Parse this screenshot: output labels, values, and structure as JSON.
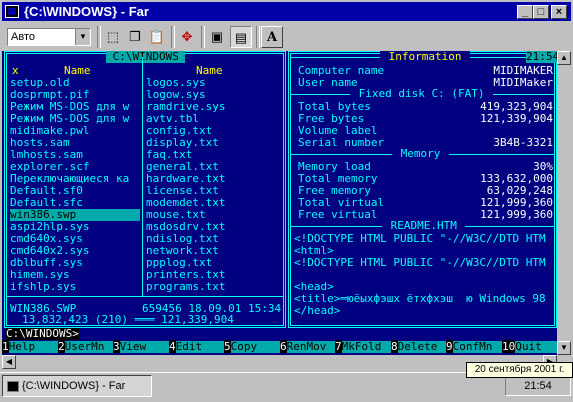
{
  "window": {
    "title": "{C:\\WINDOWS} - Far",
    "min_label": "_",
    "max_label": "□",
    "close_label": "×"
  },
  "toolbar": {
    "font_combo": "Авто",
    "icons": [
      "mark-icon",
      "copy-icon",
      "paste-icon",
      "fullscreen-icon",
      "properties-icon",
      "background-icon",
      "font-icon"
    ],
    "font_button": "A"
  },
  "left_panel": {
    "path": " C:\\WINDOWS ",
    "col_mark": "x",
    "col1_header": "Name",
    "col2_header": "Name",
    "col1": [
      "setup.old",
      "dosprmpt.pif",
      "Режим MS-DOS для w",
      "Режим MS-DOS для w",
      "midimake.pwl",
      "hosts.sam",
      "lmhosts.sam",
      "explorer.scf",
      "Переключающиеся ка",
      "Default.sf0",
      "Default.sfc",
      "win386.swp",
      "aspi2hlp.sys",
      "cmd640x.sys",
      "cmd640x2.sys",
      "dblbuff.sys",
      "himem.sys",
      "ifshlp.sys"
    ],
    "col2": [
      "logos.sys",
      "logow.sys",
      "ramdrive.sys",
      "avtv.tbl",
      "config.txt",
      "display.txt",
      "faq.txt",
      "general.txt",
      "hardware.txt",
      "license.txt",
      "modemdet.txt",
      "mouse.txt",
      "msdosdrv.txt",
      "ndislog.txt",
      "network.txt",
      "ppplog.txt",
      "printers.txt",
      "programs.txt"
    ],
    "selected_index": 11,
    "status_name": "WIN386.SWP",
    "status_info": "659456 18.09.01 15:34",
    "totals": "13,832,423 (210) ═══ 121,339,904"
  },
  "right_panel": {
    "info_title": " Information ",
    "clock": "21:54",
    "computer_label": "Computer name",
    "computer_value": "MIDIMAKER",
    "user_label": "User name",
    "user_value": "MIDIMaker",
    "disk_title": " Fixed disk C: (FAT) ",
    "total_bytes_label": "Total bytes",
    "total_bytes_value": "419,323,904",
    "free_bytes_label": "Free bytes",
    "free_bytes_value": "121,339,904",
    "volume_label": "Volume label",
    "serial_label": "Serial number",
    "serial_value": "3B4B-3321",
    "memory_title": " Memory ",
    "mem_load_label": "Memory load",
    "mem_load_value": "30%",
    "total_mem_label": "Total memory",
    "total_mem_value": "133,632,000",
    "free_mem_label": "Free memory",
    "free_mem_value": "63,029,248",
    "total_virt_label": "Total virtual",
    "total_virt_value": "121,999,360",
    "free_virt_label": "Free virtual",
    "free_virt_value": "121,999,360",
    "readme_title": " README.HTM ",
    "readme_lines": [
      "<!DOCTYPE HTML PUBLIC \"-//W3C//DTD HTM",
      "<html>",
      "<!DOCTYPE HTML PUBLIC \"-//W3C//DTD HTM",
      "",
      "<head>",
      "<title>═юёыхфэшх ётхфхэш  ю Windows 98",
      "</head>"
    ]
  },
  "command_line": "C:\\WINDOWS>",
  "keybar": [
    {
      "n": "1",
      "l": "Help"
    },
    {
      "n": "2",
      "l": "UserMn"
    },
    {
      "n": "3",
      "l": "View"
    },
    {
      "n": "4",
      "l": "Edit"
    },
    {
      "n": "5",
      "l": "Copy"
    },
    {
      "n": "6",
      "l": "RenMov"
    },
    {
      "n": "7",
      "l": "MkFold"
    },
    {
      "n": "8",
      "l": "Delete"
    },
    {
      "n": "9",
      "l": "ConfMn"
    },
    {
      "n": "10",
      "l": "Quit"
    }
  ],
  "taskbar": {
    "task_label": "{C:\\WINDOWS} - Far",
    "clock": "21:54",
    "tooltip": "20 сентября 2001 г."
  },
  "colors": {
    "console_bg": "#000080",
    "console_fg": "#00ffff",
    "highlight": "#ffff00",
    "titlebar": "#0000a8"
  }
}
